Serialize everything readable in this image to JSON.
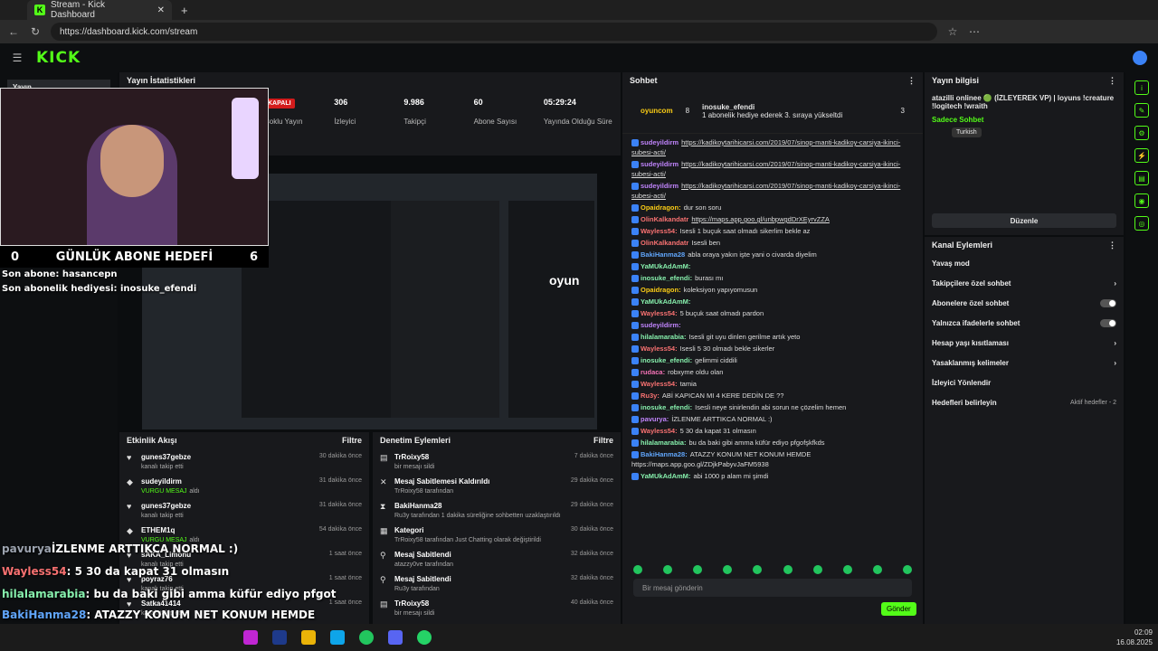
{
  "browser": {
    "tab_title": "Stream - Kick Dashboard",
    "url": "https://dashboard.kick.com/stream"
  },
  "kick": {
    "logo": "KICK"
  },
  "sidebar": {
    "item": "Yayın"
  },
  "stats": {
    "title": "Yayın İstatistikleri",
    "status": "KAPALI",
    "multistream": "Çoklu Yayın",
    "items": [
      {
        "v": "306",
        "l": "İzleyici"
      },
      {
        "v": "9.986",
        "l": "Takipçi"
      },
      {
        "v": "60",
        "l": "Abone Sayısı"
      },
      {
        "v": "05:29:24",
        "l": "Yayında Olduğu Süre"
      }
    ]
  },
  "overlay": {
    "goal_left": "0",
    "goal_text": "GÜNLÜK ABONE HEDEFİ",
    "goal_right": "6",
    "last_sub": "Son abone: hasancepn",
    "last_gift": "Son abonelik hediyesi: inosuke_efendi",
    "chat": [
      {
        "u": "pavurya",
        "t": "İZLENME ARTTIKCA NORMAL :)",
        "c": "#9ca3af"
      },
      {
        "u": "Wayless54",
        "t": ": 5 30 da kapat 31 olmasın",
        "c": "#f87171"
      },
      {
        "u": "hilalamarabia",
        "t": ": bu da baki gibi amma küfür ediyo pfgot",
        "c": "#86efac"
      },
      {
        "u": "BakiHanma28",
        "t": ": ATAZZY KONUM NET KONUM HEMDE",
        "c": "#60a5fa"
      },
      {
        "u": "YaMUkAdAmM",
        "t": ": abi 1000 p alam mi şimdi",
        "c": "#86efac"
      }
    ]
  },
  "activity": {
    "title": "Etkinlik Akışı",
    "filter": "Filtre",
    "items": [
      {
        "n": "gunes37gebze",
        "d": "kanalı takip etti",
        "tm": "30 dakika önce",
        "g": ""
      },
      {
        "n": "sudeyildirm",
        "d": "VURGU MESAJ",
        "d2": "aldı",
        "tm": "31 dakika önce",
        "g": "1"
      },
      {
        "n": "gunes37gebze",
        "d": "kanalı takip etti",
        "tm": "31 dakika önce",
        "g": ""
      },
      {
        "n": "ETHEM1q",
        "d": "VURGU MESAJ",
        "d2": "aldı",
        "tm": "54 dakika önce",
        "g": "1"
      },
      {
        "n": "sAKA_Limonu",
        "d": "kanalı takip etti",
        "tm": "1 saat önce",
        "g": ""
      },
      {
        "n": "poyraz76",
        "d": "kanalı takip etti",
        "tm": "1 saat önce",
        "g": ""
      },
      {
        "n": "Satka41414",
        "d": "kanalı takip etti",
        "tm": "1 saat önce",
        "g": ""
      }
    ]
  },
  "moderation": {
    "title": "Denetim Eylemleri",
    "filter": "Filtre",
    "items": [
      {
        "n": "TrRoixy58",
        "d": "bir mesajı sildi",
        "tm": "7 dakika önce"
      },
      {
        "n": "Mesaj Sabitlemesi Kaldırıldı",
        "d": "TrRoixy58 tarafından",
        "tm": "29 dakika önce"
      },
      {
        "n": "BakiHanma28",
        "d": "Ru3y tarafından 1 dakika süreliğine sohbetten uzaklaştırıldı",
        "tm": "29 dakika önce"
      },
      {
        "n": "Kategori",
        "d": "TrRoixy58 tarafından Just Chatting olarak değiştirildi",
        "tm": "30 dakika önce"
      },
      {
        "n": "Mesaj Sabitlendi",
        "d": "atazzy0ve tarafından",
        "tm": "32 dakika önce"
      },
      {
        "n": "Mesaj Sabitlendi",
        "d": "Ru3y tarafından",
        "tm": "32 dakika önce"
      },
      {
        "n": "TrRoixy58",
        "d": "bir mesajı sildi",
        "tm": "40 dakika önce"
      }
    ]
  },
  "chat": {
    "title": "Sohbet",
    "top_user": "oyuncom",
    "top_count": "8",
    "gift_user": "inosuke_efendi",
    "gift_count": "3",
    "gift_text": "1 abonelik hediye ederek 3. sıraya yükseltdi",
    "msgs": [
      {
        "u": "sudeyildirm",
        "t": "https://kadikoytarihicarsi.com/2019/07/sinop-manti-kadikoy-carsiya-ikinci-subesi-acti/",
        "c": "#c084fc",
        "link": true
      },
      {
        "u": "sudeyildirm",
        "t": "https://kadikoytarihicarsi.com/2019/07/sinop-manti-kadikoy-carsiya-ikinci-subesi-acti/",
        "c": "#c084fc",
        "link": true
      },
      {
        "u": "sudeyildirm",
        "t": "https://kadikoytarihicarsi.com/2019/07/sinop-manti-kadikoy-carsiya-ikinci-subesi-acti/",
        "c": "#c084fc",
        "link": true
      },
      {
        "u": "Opaidragon:",
        "t": "dur son soru",
        "c": "#facc15"
      },
      {
        "u": "OlinKalkandatr",
        "t": "https://maps.app.goo.gl/unbpwgdDrXEyrvZZA",
        "c": "#f87171",
        "link": true
      },
      {
        "u": "Wayless54:",
        "t": "Isesli 1 buçuk saat olmadı sikerlim bekle az",
        "c": "#f87171"
      },
      {
        "u": "OlinKalkandatr",
        "t": "Isesli ben",
        "c": "#f87171"
      },
      {
        "u": "BakiHanma28",
        "t": "abla oraya yakın işte yani o civarda diyelim",
        "c": "#60a5fa"
      },
      {
        "u": "YaMUkAdAmM:",
        "t": "",
        "c": "#86efac"
      },
      {
        "u": "inosuke_efendi:",
        "t": "burası mı",
        "c": "#86efac"
      },
      {
        "u": "Opaidragon:",
        "t": "koleksiyon yapıyomusun",
        "c": "#facc15"
      },
      {
        "u": "YaMUkAdAmM:",
        "t": "",
        "c": "#86efac"
      },
      {
        "u": "Wayless54:",
        "t": "5 buçuk saat olmadı pardon",
        "c": "#f87171"
      },
      {
        "u": "sudeyildirm:",
        "t": "",
        "c": "#c084fc"
      },
      {
        "u": "hilalamarabia:",
        "t": "Isesli git uyu dinlen gerilme artık yeto",
        "c": "#86efac"
      },
      {
        "u": "Wayless54:",
        "t": "Isesli 5 30 olmadı bekle sikerler",
        "c": "#f87171"
      },
      {
        "u": "inosuke_efendi:",
        "t": "gelimmi ciddili",
        "c": "#86efac"
      },
      {
        "u": "rudaca:",
        "t": "robxyme oldu olan",
        "c": "#f472b6"
      },
      {
        "u": "Wayless54:",
        "t": "tamia",
        "c": "#f87171"
      },
      {
        "u": "Ru3y:",
        "t": "ABİ KAPICAN MI 4 KERE DEDİN DE ??",
        "c": "#f87171"
      },
      {
        "u": "inosuke_efendi:",
        "t": "Isesli neye sinirlendin abi sorun ne çözelim hemen",
        "c": "#86efac"
      },
      {
        "u": "pavurya:",
        "t": "İZLENME ARTTIKCA NORMAL :)",
        "c": "#c084fc"
      },
      {
        "u": "Wayless54:",
        "t": "5 30 da kapat 31 olmasın",
        "c": "#f87171"
      },
      {
        "u": "hilalamarabia:",
        "t": "bu da baki gibi amma küfür ediyo pfgofşkfkds",
        "c": "#86efac"
      },
      {
        "u": "BakiHanma28:",
        "t": "ATAZZY KONUM NET KONUM HEMDE https://maps.app.goo.gl/ZDjkPabyvJaFM5938",
        "c": "#60a5fa"
      },
      {
        "u": "YaMUkAdAmM:",
        "t": "abi 1000 p alam mi şimdi",
        "c": "#86efac"
      }
    ],
    "input_placeholder": "Bir mesaj gönderin",
    "send": "Gönder"
  },
  "info": {
    "title": "Yayın bilgisi",
    "stream_title": "atazilli onlinee 🟢 (İZLEYEREK VP) | loyuns !creature !logitech !wraith",
    "category": "Sadece Sohbet",
    "tag": "Turkish",
    "edit": "Düzenle"
  },
  "actions": {
    "title": "Kanal Eylemleri",
    "items": [
      "Yavaş mod",
      "Takipçilere özel sohbet",
      "Abonelere özel sohbet",
      "Yalnızca ifadelerle sohbet",
      "Hesap yaşı kısıtlaması",
      "Yasaklanmış kelimeler",
      "İzleyici Yönlendir",
      "Hedefleri belirleyin"
    ],
    "goal_hint": "Aktif hedefler - 2"
  },
  "taskbar": {
    "time": "02:09",
    "date": "16.08.2025"
  },
  "colors": {
    "accent": "#53fc18",
    "panel": "#18191c"
  }
}
